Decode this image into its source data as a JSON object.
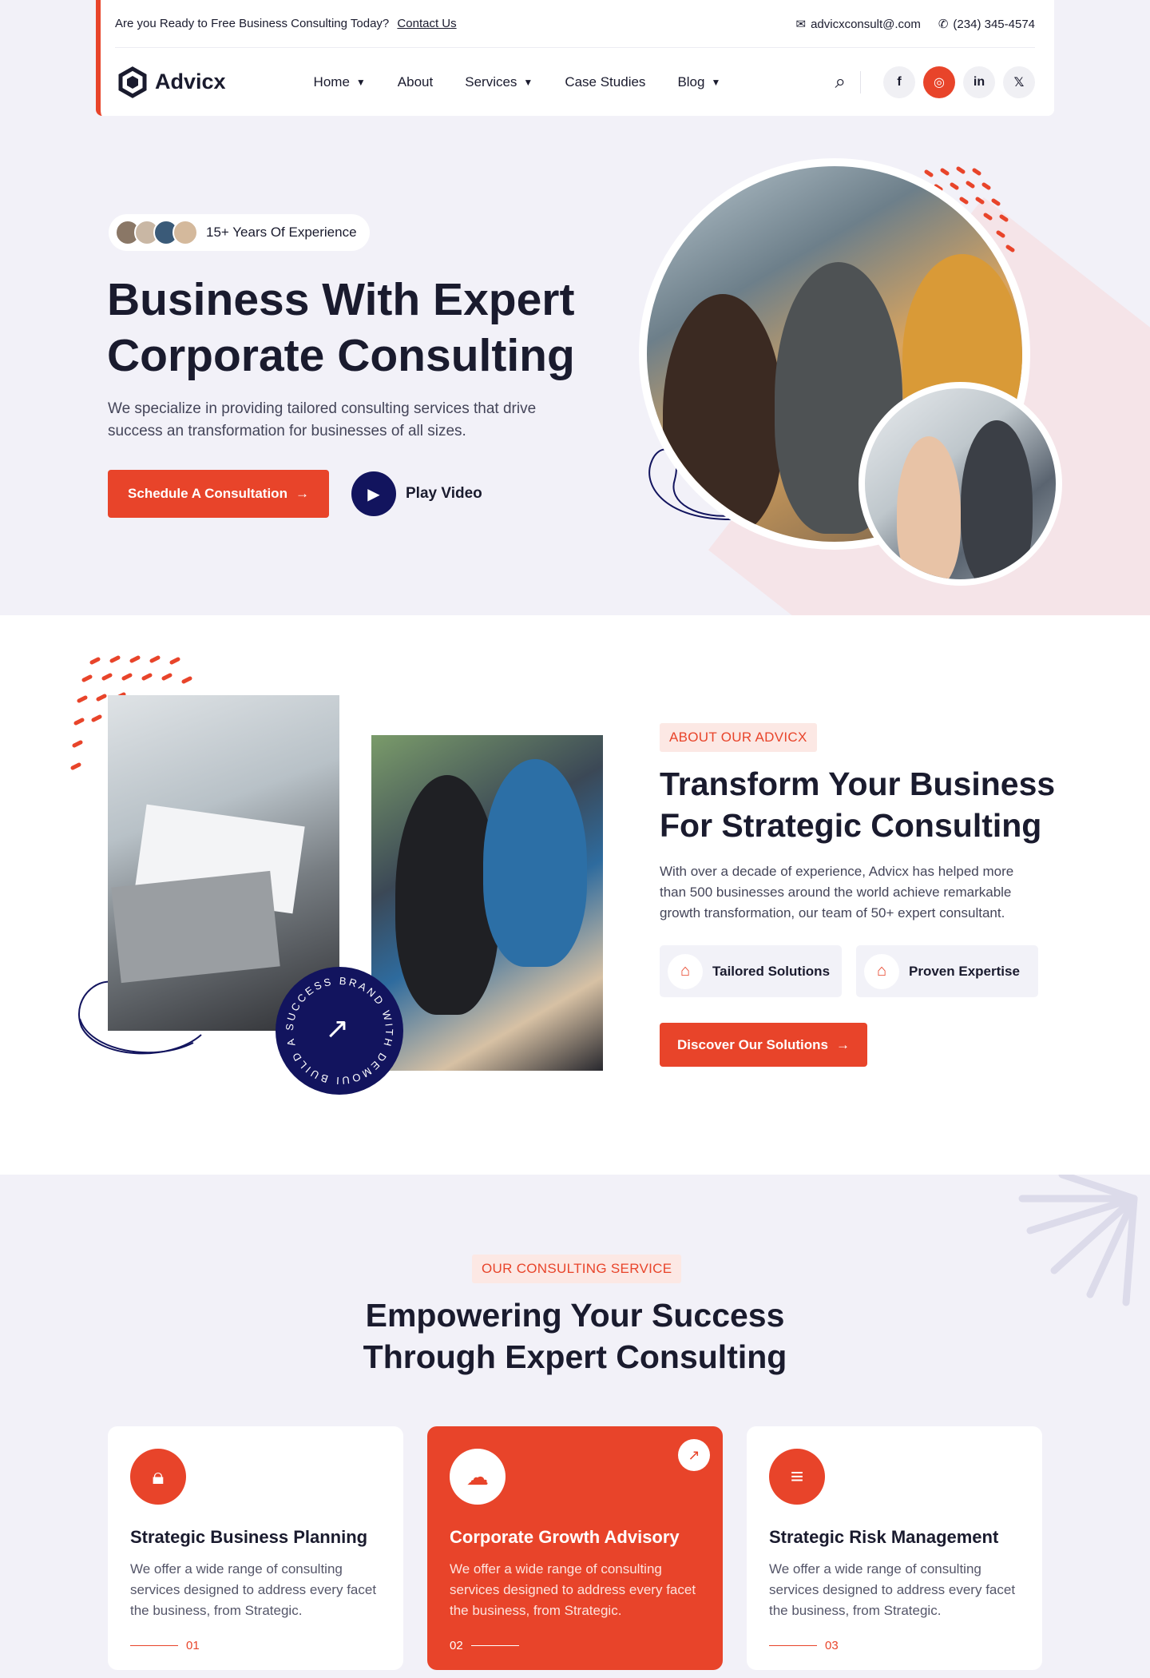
{
  "topbar": {
    "promo_text": "Are you Ready to Free Business Consulting Today?",
    "contact_link": "Contact Us",
    "email": "advicxconsult@.com",
    "phone": "(234) 345-4574"
  },
  "header": {
    "brand": "Advicx",
    "nav": [
      {
        "label": "Home",
        "has_dropdown": true
      },
      {
        "label": "About",
        "has_dropdown": false
      },
      {
        "label": "Services",
        "has_dropdown": true
      },
      {
        "label": "Case Studies",
        "has_dropdown": false
      },
      {
        "label": "Blog",
        "has_dropdown": true
      }
    ],
    "social": [
      {
        "icon": "facebook-icon",
        "glyph": "f"
      },
      {
        "icon": "instagram-icon",
        "glyph": "◎"
      },
      {
        "icon": "linkedin-icon",
        "glyph": "in"
      },
      {
        "icon": "x-icon",
        "glyph": "𝕏"
      }
    ]
  },
  "hero": {
    "experience_badge": "15+ Years Of Experience",
    "title_line1": "Business With Expert",
    "title_line2": "Corporate Consulting",
    "lead": "We specialize in providing tailored consulting services that drive success an transformation for businesses of all sizes.",
    "primary_cta": "Schedule A Consultation",
    "video_cta": "Play Video"
  },
  "about": {
    "tag": "ABOUT OUR ADVICX",
    "title_line1": "Transform Your Business",
    "title_line2": "For Strategic Consulting",
    "paragraph": "With over a decade of experience, Advicx has helped more than 500 businesses around the world achieve remarkable growth transformation, our team of 50+ expert consultant.",
    "features": [
      "Tailored Solutions",
      "Proven Expertise"
    ],
    "cta": "Discover Our Solutions",
    "circle_badge_text": "SUCCESS BRAND WITH DEMOUI BUILD A"
  },
  "services": {
    "tag": "OUR CONSULTING SERVICE",
    "title_line1": "Empowering Your Success",
    "title_line2": "Through Expert Consulting",
    "cards": [
      {
        "title": "Strategic Business Planning",
        "text": "We offer a wide range of consulting services designed to address every facet the business, from Strategic.",
        "num": "01"
      },
      {
        "title": "Corporate Growth Advisory",
        "text": "We offer a wide range of consulting services designed to address every facet the business, from Strategic.",
        "num": "02"
      },
      {
        "title": "Strategic Risk Management",
        "text": "We offer a wide range of consulting services designed to address every facet the business, from Strategic.",
        "num": "03"
      }
    ]
  },
  "colors": {
    "accent": "#e8442a",
    "navy": "#12145e",
    "bg_light": "#f2f1f8"
  }
}
